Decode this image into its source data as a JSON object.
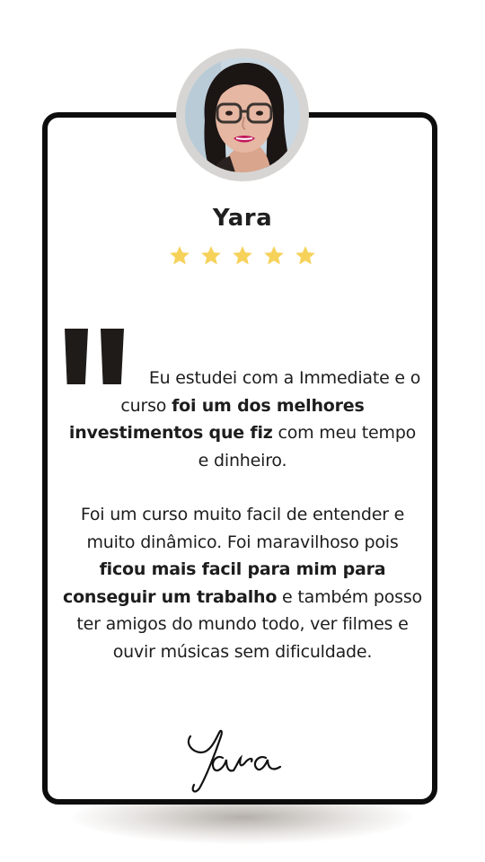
{
  "reviewer": {
    "name": "Yara",
    "rating": 5,
    "max_rating": 5,
    "avatar": "woman-with-glasses-photo"
  },
  "colors": {
    "star": "#f6d25b",
    "border": "#0d0d0d",
    "ring": "#d6d5d3",
    "text": "#1d1d1d"
  },
  "icons": {
    "star": "star-icon",
    "quote": "quote-mark-icon"
  },
  "testimonial": {
    "p1": {
      "a": "Eu estudei com a Immediate e o curso ",
      "b": "foi um dos melhores investimentos que fiz",
      "c": " com meu tempo e dinheiro."
    },
    "p2": {
      "a": "Foi um curso muito facil de entender e muito dinâmico. Foi maravilhoso pois ",
      "b": "ficou mais facil para mim para conseguir um trabalho",
      "c": " e também posso ter amigos do mundo todo, ver filmes e ouvir músicas sem dificuldade."
    }
  },
  "signature": "Yara"
}
